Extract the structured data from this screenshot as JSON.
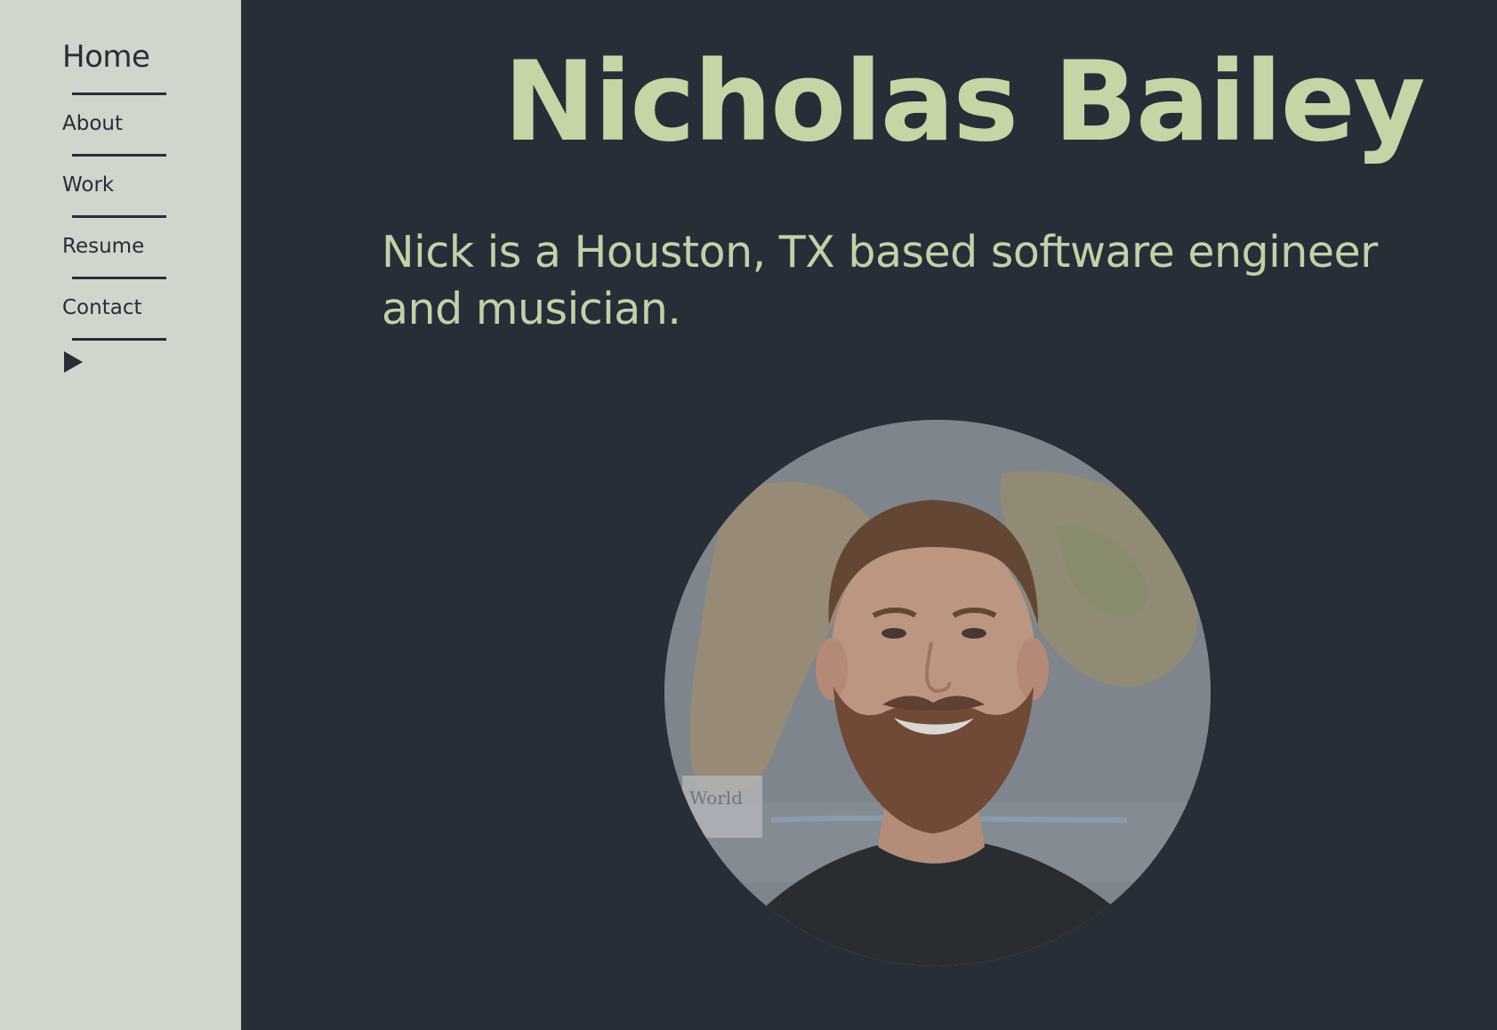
{
  "sidebar": {
    "items": [
      {
        "label": "Home"
      },
      {
        "label": "About"
      },
      {
        "label": "Work"
      },
      {
        "label": "Resume"
      },
      {
        "label": "Contact"
      }
    ],
    "play_icon": "play-icon"
  },
  "main": {
    "title": "Nicholas Bailey",
    "intro": "Nick is a Houston, TX based software engineer and musician.",
    "portrait_icon": "profile-photo"
  },
  "colors": {
    "sidebar_bg": "#d0d6cc",
    "main_bg": "#272e37",
    "accent_text": "#c5d5a6",
    "nav_text": "#272e37"
  }
}
